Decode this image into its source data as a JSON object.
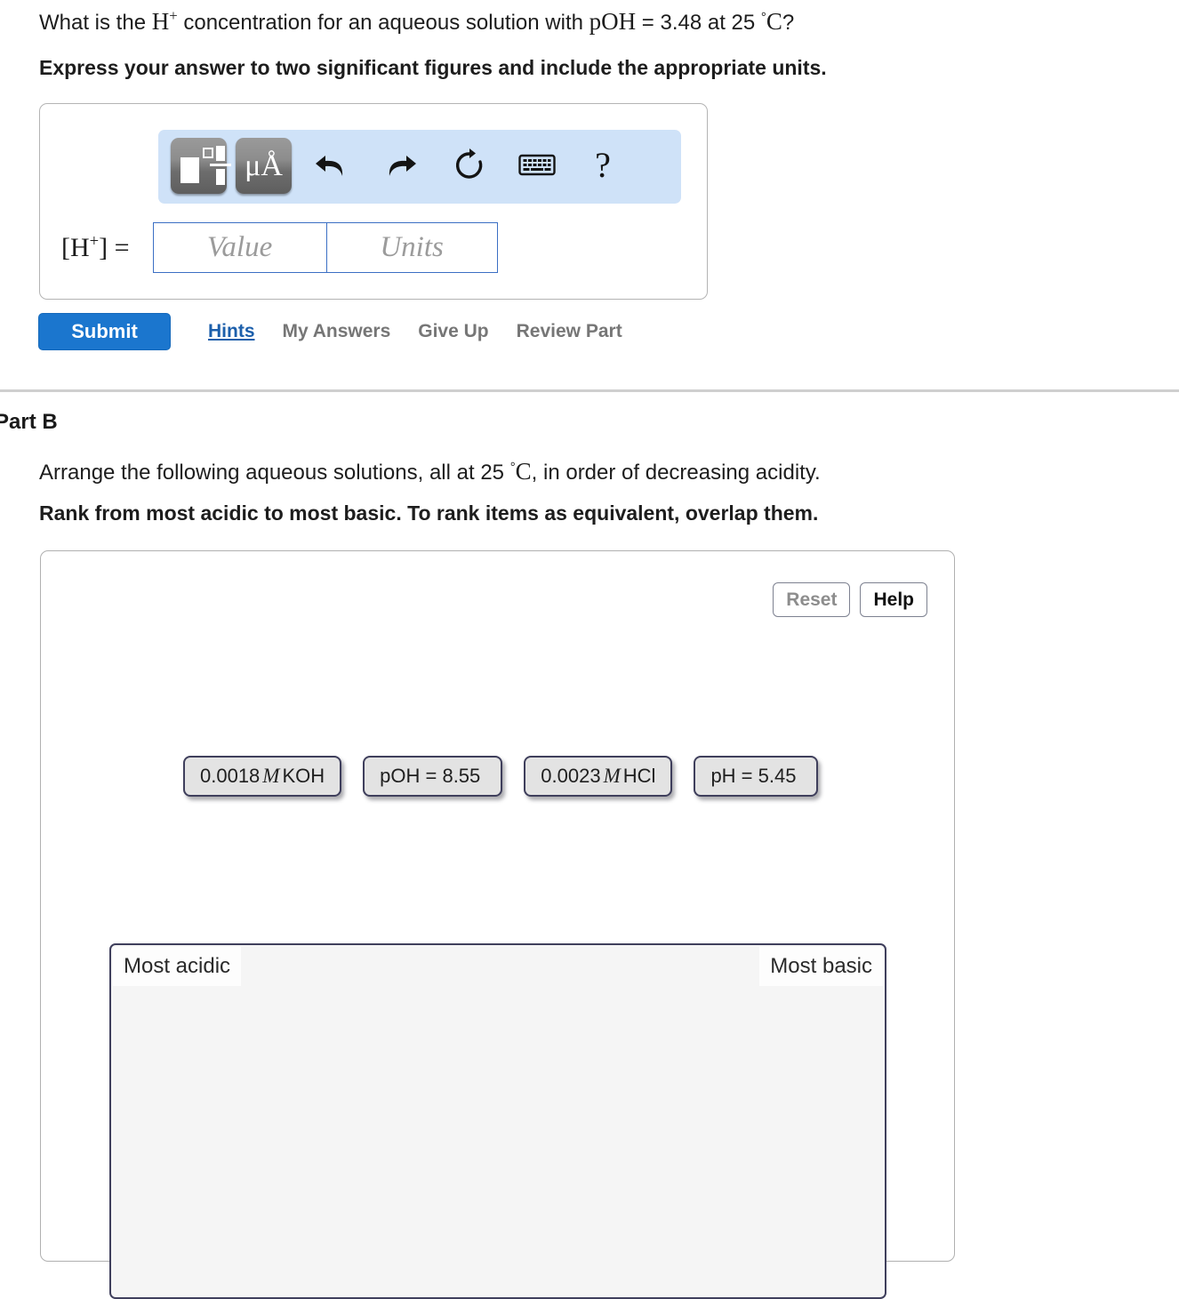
{
  "part_a": {
    "question_prefix": "What is the ",
    "question_species": "H",
    "question_species_charge": "+",
    "question_mid": " concentration for an aqueous solution with ",
    "question_poh_symbol": "pOH",
    "question_poh_value": " = 3.48 at 25 ",
    "question_degree": "°",
    "question_celsius": "C",
    "question_suffix": "?",
    "instruction": "Express your answer to two significant figures and include the appropriate units.",
    "toolbar": {
      "template_button": "template-icon",
      "unit_button": "μÅ",
      "undo": "undo-arrow",
      "redo": "redo-arrow",
      "reset": "reset-circular-arrow",
      "keypad": "keyboard",
      "help": "?"
    },
    "answer": {
      "label_open": "[",
      "label_species": "H",
      "label_charge": "+",
      "label_close": "] =",
      "value_placeholder": "Value",
      "units_placeholder": "Units"
    },
    "actions": {
      "submit": "Submit",
      "hints": "Hints",
      "my_answers": "My Answers",
      "give_up": "Give Up",
      "review_part": "Review Part"
    }
  },
  "part_b": {
    "title": "Part B",
    "question_prefix": "Arrange the following aqueous solutions, all at 25 ",
    "question_degree": "°",
    "question_celsius": "C",
    "question_suffix": ", in order of decreasing acidity.",
    "instruction": "Rank from most acidic to most basic. To rank items as equivalent, overlap them.",
    "buttons": {
      "reset": "Reset",
      "help": "Help"
    },
    "tiles": [
      {
        "pre": "0.0018 ",
        "italic": "M",
        "post": " KOH",
        "full": "0.0018 M KOH"
      },
      {
        "pre": "pOH = 8.55",
        "italic": "",
        "post": "",
        "full": "pOH = 8.55"
      },
      {
        "pre": "0.0023 ",
        "italic": "M",
        "post": " HCl",
        "full": "0.0023 M HCl"
      },
      {
        "pre": "pH = 5.45",
        "italic": "",
        "post": "",
        "full": "pH = 5.45"
      }
    ],
    "bin": {
      "left_label": "Most acidic",
      "right_label": "Most basic"
    }
  },
  "colors": {
    "accent_blue": "#1b76ce",
    "link_blue": "#1c5fab",
    "toolbar_blue": "#cfe2f8",
    "field_border": "#3b6fc4",
    "tile_border": "#3f3f5c",
    "tile_fill": "#e3e3e3",
    "bin_fill": "#f5f5f5",
    "muted_text": "#767676"
  }
}
